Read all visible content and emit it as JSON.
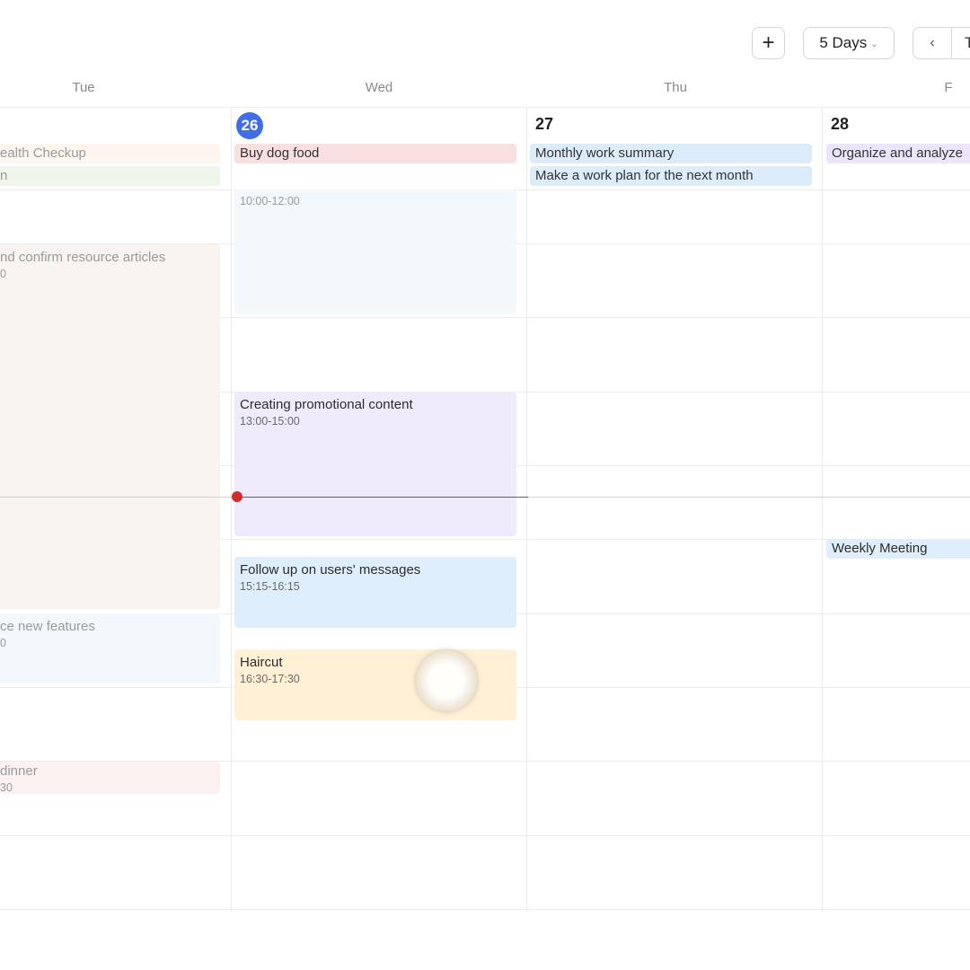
{
  "toolbar": {
    "add_label": "+",
    "view_label": "5 Days",
    "view_chevron": "⌄",
    "prev_label": "‹",
    "today_label": "T"
  },
  "days": {
    "tue": "Tue",
    "wed": "Wed",
    "thu": "Thu",
    "fri": "F"
  },
  "dates": {
    "wed": "26",
    "thu": "27",
    "fri": "28"
  },
  "allday": {
    "tue_1": "ealth Checkup",
    "tue_2": "n",
    "wed_1": "Buy dog food",
    "thu_1": "Monthly work summary",
    "thu_2": "Make a work plan for the next month",
    "fri_1": "Organize and analyze"
  },
  "events": {
    "tue_resource": {
      "title": "nd confirm resource articles",
      "time": "0"
    },
    "tue_features": {
      "title": "ce new features",
      "time": "0"
    },
    "tue_dinner": {
      "title": "dinner",
      "time": "30"
    },
    "wed_morning": {
      "time": "10:00-12:00"
    },
    "wed_promo": {
      "title": "Creating promotional content",
      "time": "13:00-15:00"
    },
    "wed_followup": {
      "title": "Follow up on users' messages",
      "time": "15:15-16:15"
    },
    "wed_haircut": {
      "title": "Haircut",
      "time": "16:30-17:30"
    },
    "fri_weekly": {
      "title": "Weekly Meeting"
    }
  },
  "colors": {
    "today_accent": "#3f6ee8",
    "now_line": "#cf2e2e"
  }
}
